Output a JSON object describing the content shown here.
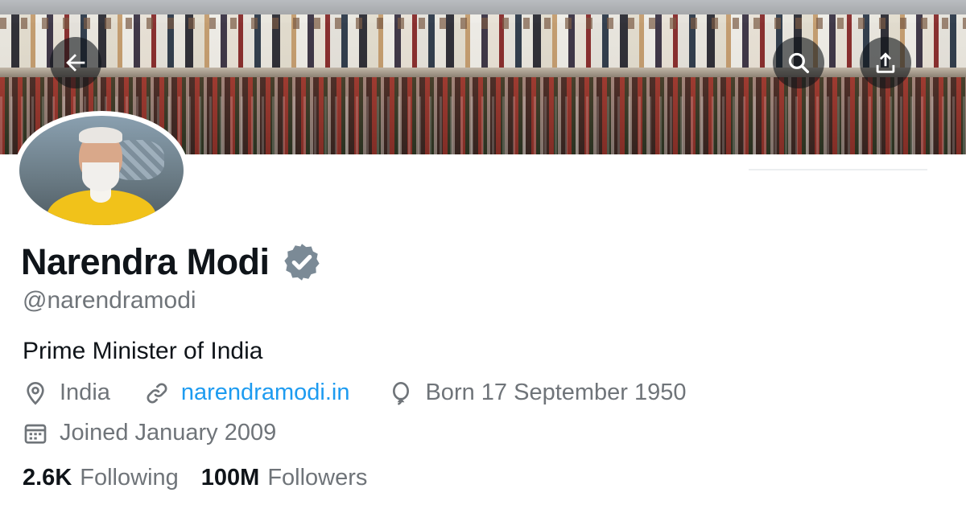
{
  "header": {
    "buttons": {
      "back": {
        "icon": "back-arrow-icon"
      },
      "search": {
        "icon": "search-icon"
      },
      "share": {
        "icon": "share-icon"
      }
    }
  },
  "profile": {
    "name": "Narendra Modi",
    "verified_icon": "verified-badge-icon",
    "handle": "@narendramodi",
    "bio": "Prime Minister of India",
    "location": "India",
    "website": "narendramodi.in",
    "birthday": "Born 17 September 1950",
    "joined": "Joined January 2009",
    "following_count": "2.6K",
    "following_label": "Following",
    "followers_count": "100M",
    "followers_label": "Followers"
  },
  "colors": {
    "link": "#1d9bf0",
    "secondary_text": "#6f7479",
    "primary_text": "#0f1419",
    "verified_badge": "#7b8a96"
  }
}
